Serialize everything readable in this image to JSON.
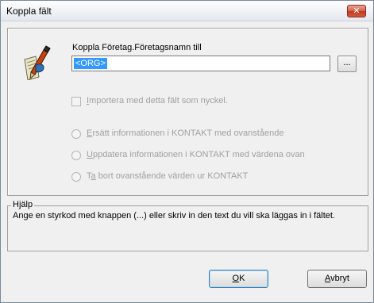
{
  "window": {
    "title": "Koppla fält",
    "close_label": "✕"
  },
  "field": {
    "label": "Koppla Företag.Företagsnamn till",
    "value": "<ORG>",
    "browse_label": "..."
  },
  "checkbox": {
    "hotkey": "I",
    "rest": "mportera med detta fält som nyckel."
  },
  "radios": [
    {
      "before": "",
      "hotkey": "E",
      "rest": "rsätt informationen i KONTAKT med ovanstående"
    },
    {
      "before": "",
      "hotkey": "U",
      "rest": "ppdatera informationen i KONTAKT med värdena ovan"
    },
    {
      "before": "T",
      "hotkey": "a",
      "rest": " bort ovanstående värden ur KONTAKT"
    }
  ],
  "help": {
    "legend": "Hjälp",
    "text": "Ange en styrkod med knappen (...) eller skriv in den text du vill ska läggas in i fältet."
  },
  "buttons": {
    "ok": {
      "hotkey": "O",
      "rest": "K"
    },
    "cancel": {
      "hotkey": "A",
      "rest": "vbryt"
    }
  },
  "icons": {
    "field_icon": "pen-and-paper-icon"
  }
}
